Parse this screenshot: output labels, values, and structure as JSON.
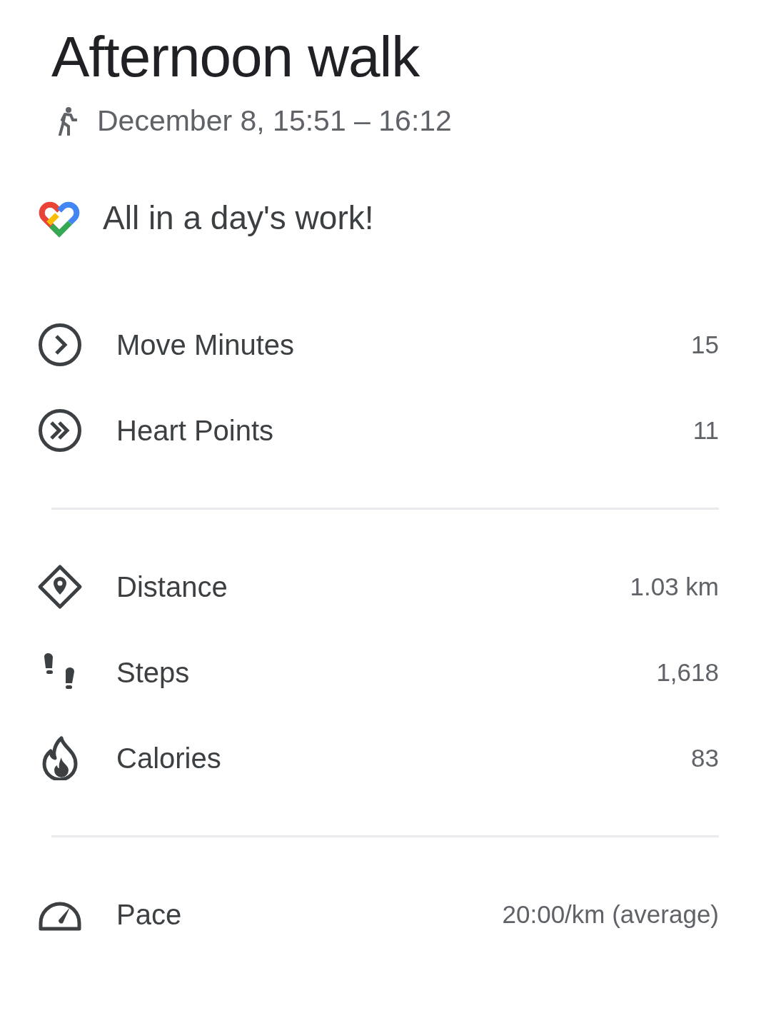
{
  "title": "Afternoon walk",
  "subtitle": "December 8, 15:51 – 16:12",
  "message": "All in a day's work!",
  "sections": [
    {
      "rows": [
        {
          "kind": "move",
          "label": "Move Minutes",
          "value": "15"
        },
        {
          "kind": "heart",
          "label": "Heart Points",
          "value": "11"
        }
      ]
    },
    {
      "rows": [
        {
          "kind": "distance",
          "label": "Distance",
          "value": "1.03 km"
        },
        {
          "kind": "steps",
          "label": "Steps",
          "value": "1,618"
        },
        {
          "kind": "calories",
          "label": "Calories",
          "value": "83"
        }
      ]
    },
    {
      "rows": [
        {
          "kind": "pace",
          "label": "Pace",
          "value": "20:00/km (average)"
        }
      ]
    }
  ]
}
